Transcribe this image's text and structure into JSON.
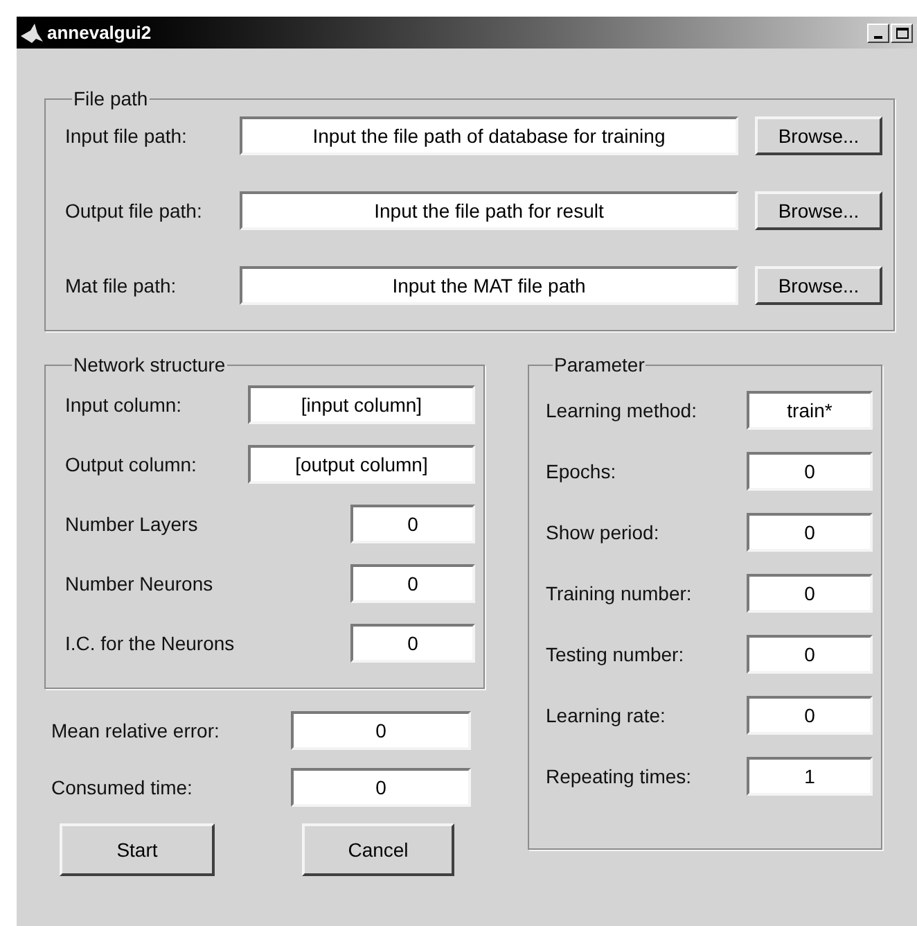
{
  "window": {
    "title": "annevalgui2"
  },
  "file_path": {
    "title": "File path",
    "rows": [
      {
        "label": "Input file path:",
        "value": "Input the file path of database for training",
        "button": "Browse..."
      },
      {
        "label": "Output file path:",
        "value": "Input the file path for result",
        "button": "Browse..."
      },
      {
        "label": "Mat file path:",
        "value": "Input the MAT file path",
        "button": "Browse..."
      }
    ]
  },
  "network_structure": {
    "title": "Network structure",
    "rows": [
      {
        "label": "Input column:",
        "value": "[input column]",
        "kind": "wide"
      },
      {
        "label": "Output column:",
        "value": "[output column]",
        "kind": "wide"
      },
      {
        "label": "Number Layers",
        "value": "0",
        "kind": "narrow"
      },
      {
        "label": "Number Neurons",
        "value": "0",
        "kind": "narrow"
      },
      {
        "label": "I.C. for the Neurons",
        "value": "0",
        "kind": "narrow"
      }
    ]
  },
  "results": [
    {
      "label": "Mean relative error:",
      "value": "0"
    },
    {
      "label": "Consumed time:",
      "value": "0"
    }
  ],
  "buttons": [
    "Start",
    "Cancel"
  ],
  "parameter": {
    "title": "Parameter",
    "rows": [
      {
        "label": "Learning method:",
        "value": "train*"
      },
      {
        "label": "Epochs:",
        "value": "0"
      },
      {
        "label": "Show period:",
        "value": "0"
      },
      {
        "label": "Training number:",
        "value": "0"
      },
      {
        "label": "Testing number:",
        "value": "0"
      },
      {
        "label": "Learning rate:",
        "value": "0"
      },
      {
        "label": "Repeating times:",
        "value": "1"
      }
    ]
  }
}
